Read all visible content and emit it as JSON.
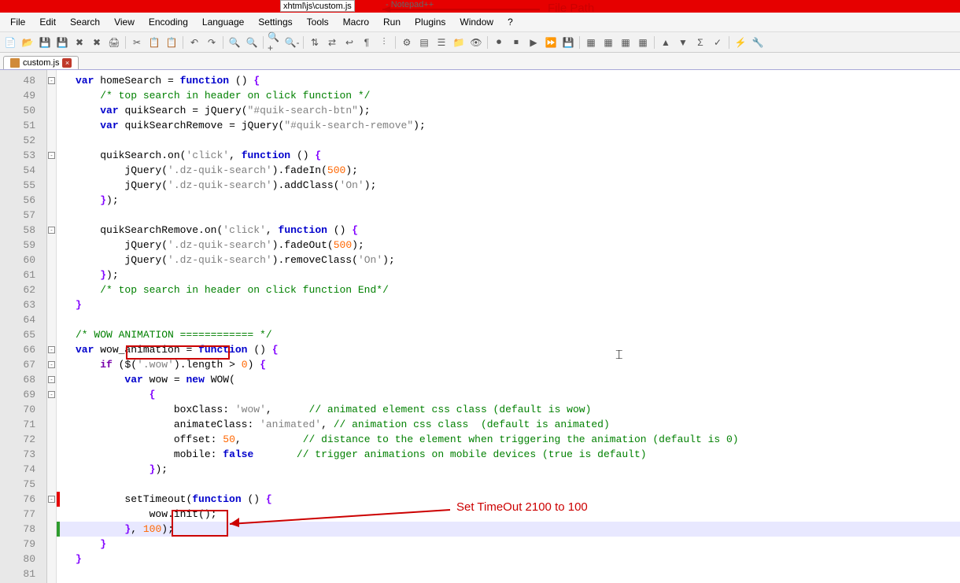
{
  "title": {
    "path": "xhtml\\js\\custom.js",
    "app": "Notepad++"
  },
  "menus": [
    "File",
    "Edit",
    "Search",
    "View",
    "Encoding",
    "Language",
    "Settings",
    "Tools",
    "Macro",
    "Run",
    "Plugins",
    "Window",
    "?"
  ],
  "tab": {
    "name": "custom.js"
  },
  "lines": {
    "start": 48,
    "end": 81,
    "fold": {
      "48": "-",
      "53": "-",
      "58": "-",
      "66": "-",
      "67": "-",
      "68": "-",
      "69": "-",
      "76": "-"
    },
    "change": {
      "76": "red",
      "78": "green"
    },
    "highlight": 78,
    "code": {
      "48": [
        [
          "kw",
          "var"
        ],
        [
          "op",
          " "
        ],
        [
          "ident",
          "homeSearch"
        ],
        [
          "op",
          " "
        ],
        [
          "op",
          "="
        ],
        [
          "op",
          " "
        ],
        [
          "kw",
          "function"
        ],
        [
          "op",
          " "
        ],
        [
          "paren",
          "("
        ],
        [
          "paren",
          ")"
        ],
        [
          "op",
          " "
        ],
        [
          "brace",
          "{"
        ]
      ],
      "49": [
        [
          "op",
          "    "
        ],
        [
          "cmt",
          "/* top search in header on click function */"
        ]
      ],
      "50": [
        [
          "op",
          "    "
        ],
        [
          "kw",
          "var"
        ],
        [
          "op",
          " "
        ],
        [
          "ident",
          "quikSearch"
        ],
        [
          "op",
          " "
        ],
        [
          "op",
          "="
        ],
        [
          "op",
          " "
        ],
        [
          "ident",
          "jQuery"
        ],
        [
          "paren",
          "("
        ],
        [
          "str",
          "\"#quik-search-btn\""
        ],
        [
          "paren",
          ")"
        ],
        [
          "op",
          ";"
        ]
      ],
      "51": [
        [
          "op",
          "    "
        ],
        [
          "kw",
          "var"
        ],
        [
          "op",
          " "
        ],
        [
          "ident",
          "quikSearchRemove"
        ],
        [
          "op",
          " "
        ],
        [
          "op",
          "="
        ],
        [
          "op",
          " "
        ],
        [
          "ident",
          "jQuery"
        ],
        [
          "paren",
          "("
        ],
        [
          "str",
          "\"#quik-search-remove\""
        ],
        [
          "paren",
          ")"
        ],
        [
          "op",
          ";"
        ]
      ],
      "52": [],
      "53": [
        [
          "op",
          "    "
        ],
        [
          "ident",
          "quikSearch"
        ],
        [
          "op",
          "."
        ],
        [
          "fn",
          "on"
        ],
        [
          "paren",
          "("
        ],
        [
          "str",
          "'click'"
        ],
        [
          "op",
          ","
        ],
        [
          "op",
          " "
        ],
        [
          "kw",
          "function"
        ],
        [
          "op",
          " "
        ],
        [
          "paren",
          "("
        ],
        [
          "paren",
          ")"
        ],
        [
          "op",
          " "
        ],
        [
          "brace",
          "{"
        ]
      ],
      "54": [
        [
          "op",
          "        "
        ],
        [
          "ident",
          "jQuery"
        ],
        [
          "paren",
          "("
        ],
        [
          "str",
          "'.dz-quik-search'"
        ],
        [
          "paren",
          ")"
        ],
        [
          "op",
          "."
        ],
        [
          "fn",
          "fadeIn"
        ],
        [
          "paren",
          "("
        ],
        [
          "num",
          "500"
        ],
        [
          "paren",
          ")"
        ],
        [
          "op",
          ";"
        ]
      ],
      "55": [
        [
          "op",
          "        "
        ],
        [
          "ident",
          "jQuery"
        ],
        [
          "paren",
          "("
        ],
        [
          "str",
          "'.dz-quik-search'"
        ],
        [
          "paren",
          ")"
        ],
        [
          "op",
          "."
        ],
        [
          "fn",
          "addClass"
        ],
        [
          "paren",
          "("
        ],
        [
          "str",
          "'On'"
        ],
        [
          "paren",
          ")"
        ],
        [
          "op",
          ";"
        ]
      ],
      "56": [
        [
          "op",
          "    "
        ],
        [
          "brace",
          "}"
        ],
        [
          "paren",
          ")"
        ],
        [
          "op",
          ";"
        ]
      ],
      "57": [],
      "58": [
        [
          "op",
          "    "
        ],
        [
          "ident",
          "quikSearchRemove"
        ],
        [
          "op",
          "."
        ],
        [
          "fn",
          "on"
        ],
        [
          "paren",
          "("
        ],
        [
          "str",
          "'click'"
        ],
        [
          "op",
          ","
        ],
        [
          "op",
          " "
        ],
        [
          "kw",
          "function"
        ],
        [
          "op",
          " "
        ],
        [
          "paren",
          "("
        ],
        [
          "paren",
          ")"
        ],
        [
          "op",
          " "
        ],
        [
          "brace",
          "{"
        ]
      ],
      "59": [
        [
          "op",
          "        "
        ],
        [
          "ident",
          "jQuery"
        ],
        [
          "paren",
          "("
        ],
        [
          "str",
          "'.dz-quik-search'"
        ],
        [
          "paren",
          ")"
        ],
        [
          "op",
          "."
        ],
        [
          "fn",
          "fadeOut"
        ],
        [
          "paren",
          "("
        ],
        [
          "num",
          "500"
        ],
        [
          "paren",
          ")"
        ],
        [
          "op",
          ";"
        ]
      ],
      "60": [
        [
          "op",
          "        "
        ],
        [
          "ident",
          "jQuery"
        ],
        [
          "paren",
          "("
        ],
        [
          "str",
          "'.dz-quik-search'"
        ],
        [
          "paren",
          ")"
        ],
        [
          "op",
          "."
        ],
        [
          "fn",
          "removeClass"
        ],
        [
          "paren",
          "("
        ],
        [
          "str",
          "'On'"
        ],
        [
          "paren",
          ")"
        ],
        [
          "op",
          ";"
        ]
      ],
      "61": [
        [
          "op",
          "    "
        ],
        [
          "brace",
          "}"
        ],
        [
          "paren",
          ")"
        ],
        [
          "op",
          ";"
        ]
      ],
      "62": [
        [
          "op",
          "    "
        ],
        [
          "cmt",
          "/* top search in header on click function End*/"
        ]
      ],
      "63": [
        [
          "brace",
          "}"
        ]
      ],
      "64": [],
      "65": [
        [
          "cmt",
          "/* WOW ANIMATION ============ */"
        ]
      ],
      "66": [
        [
          "kw",
          "var"
        ],
        [
          "op",
          " "
        ],
        [
          "ident",
          "wow_animation"
        ],
        [
          "op",
          " "
        ],
        [
          "op",
          "="
        ],
        [
          "op",
          " "
        ],
        [
          "kw",
          "function"
        ],
        [
          "op",
          " "
        ],
        [
          "paren",
          "("
        ],
        [
          "paren",
          ")"
        ],
        [
          "op",
          " "
        ],
        [
          "brace",
          "{"
        ]
      ],
      "67": [
        [
          "op",
          "    "
        ],
        [
          "kw2",
          "if"
        ],
        [
          "op",
          " "
        ],
        [
          "paren",
          "("
        ],
        [
          "ident",
          "$"
        ],
        [
          "paren",
          "("
        ],
        [
          "str",
          "'.wow'"
        ],
        [
          "paren",
          ")"
        ],
        [
          "op",
          "."
        ],
        [
          "ident",
          "length"
        ],
        [
          "op",
          " "
        ],
        [
          "op",
          ">"
        ],
        [
          "op",
          " "
        ],
        [
          "num",
          "0"
        ],
        [
          "paren",
          ")"
        ],
        [
          "op",
          " "
        ],
        [
          "brace",
          "{"
        ]
      ],
      "68": [
        [
          "op",
          "        "
        ],
        [
          "kw",
          "var"
        ],
        [
          "op",
          " "
        ],
        [
          "ident",
          "wow"
        ],
        [
          "op",
          " "
        ],
        [
          "op",
          "="
        ],
        [
          "op",
          " "
        ],
        [
          "kw",
          "new"
        ],
        [
          "op",
          " "
        ],
        [
          "ident",
          "WOW"
        ],
        [
          "paren",
          "("
        ]
      ],
      "69": [
        [
          "op",
          "            "
        ],
        [
          "brace",
          "{"
        ]
      ],
      "70": [
        [
          "op",
          "                "
        ],
        [
          "ident",
          "boxClass"
        ],
        [
          "op",
          ":"
        ],
        [
          "op",
          " "
        ],
        [
          "str",
          "'wow'"
        ],
        [
          "op",
          ","
        ],
        [
          "op",
          "      "
        ],
        [
          "cmt",
          "// animated element css class (default is wow)"
        ]
      ],
      "71": [
        [
          "op",
          "                "
        ],
        [
          "ident",
          "animateClass"
        ],
        [
          "op",
          ":"
        ],
        [
          "op",
          " "
        ],
        [
          "str",
          "'animated'"
        ],
        [
          "op",
          ","
        ],
        [
          "op",
          " "
        ],
        [
          "cmt",
          "// animation css class  (default is animated)"
        ]
      ],
      "72": [
        [
          "op",
          "                "
        ],
        [
          "ident",
          "offset"
        ],
        [
          "op",
          ":"
        ],
        [
          "op",
          " "
        ],
        [
          "num",
          "50"
        ],
        [
          "op",
          ","
        ],
        [
          "op",
          "          "
        ],
        [
          "cmt",
          "// distance to the element when triggering the animation (default is 0)"
        ]
      ],
      "73": [
        [
          "op",
          "                "
        ],
        [
          "ident",
          "mobile"
        ],
        [
          "op",
          ":"
        ],
        [
          "op",
          " "
        ],
        [
          "kw",
          "false"
        ],
        [
          "op",
          "       "
        ],
        [
          "cmt",
          "// trigger animations on mobile devices (true is default)"
        ]
      ],
      "74": [
        [
          "op",
          "            "
        ],
        [
          "brace",
          "}"
        ],
        [
          "paren",
          ")"
        ],
        [
          "op",
          ";"
        ]
      ],
      "75": [],
      "76": [
        [
          "op",
          "        "
        ],
        [
          "ident",
          "setTimeout"
        ],
        [
          "paren",
          "("
        ],
        [
          "kw",
          "function"
        ],
        [
          "op",
          " "
        ],
        [
          "paren",
          "("
        ],
        [
          "paren",
          ")"
        ],
        [
          "op",
          " "
        ],
        [
          "brace",
          "{"
        ]
      ],
      "77": [
        [
          "op",
          "            "
        ],
        [
          "ident",
          "wow"
        ],
        [
          "op",
          "."
        ],
        [
          "fn",
          "init"
        ],
        [
          "paren",
          "("
        ],
        [
          "paren",
          ")"
        ],
        [
          "op",
          ";"
        ]
      ],
      "78": [
        [
          "op",
          "        "
        ],
        [
          "brace",
          "}"
        ],
        [
          "op",
          ","
        ],
        [
          "op",
          " "
        ],
        [
          "num",
          "100"
        ],
        [
          "paren",
          ")"
        ],
        [
          "op",
          ";"
        ]
      ],
      "79": [
        [
          "op",
          "    "
        ],
        [
          "brace",
          "}"
        ]
      ],
      "80": [
        [
          "brace",
          "}"
        ]
      ],
      "81": []
    }
  },
  "annotations": {
    "filepath_label": "File Path",
    "timeout_label": "Set TimeOut 2100 to 100"
  }
}
